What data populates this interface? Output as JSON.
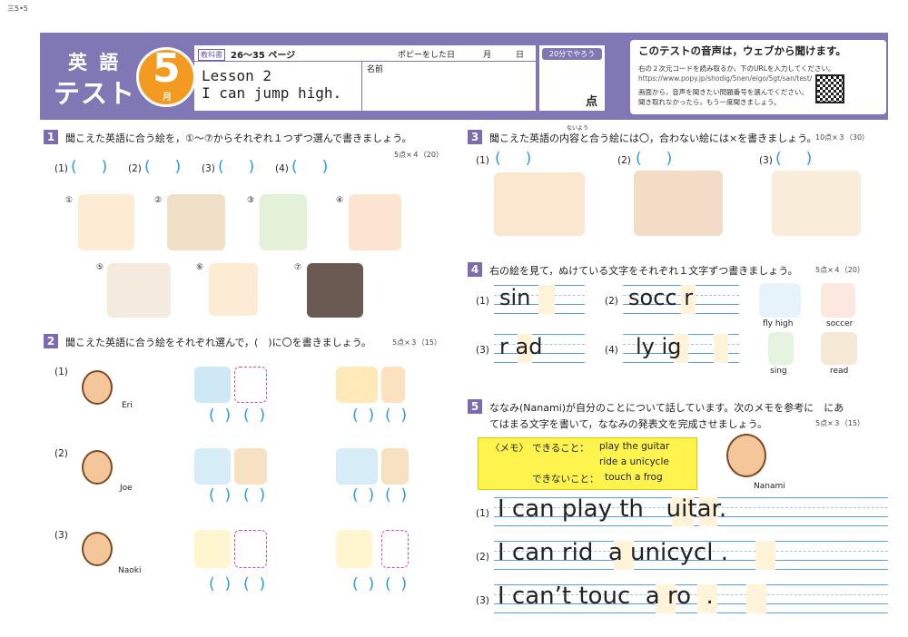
{
  "corner": "三5•5",
  "header": {
    "subject1": "英 語",
    "subject2": "テスト",
    "month_num": "5",
    "month_unit": "月",
    "textbook_tag": "教科書",
    "pages": "26〜35 ページ",
    "did_label": "ポピーをした日",
    "month_label": "月",
    "day_label": "日",
    "lesson": "Lesson 2",
    "lesson_title": "I can jump high.",
    "name_label": "名前",
    "time_tag": "20分でやろう",
    "score_unit": "点"
  },
  "audio": {
    "title": "このテストの音声は，ウェブから聞けます。",
    "line1": "右の２次元コードを読み取るか，下のURLを入力してください。",
    "url": "https://www.popy.jp/shodig/5nen/eigo/5gt/san/test/",
    "line3": "画面から，音声を聞きたい問題番号を選んでください。",
    "line4": "聞き取れなかったら，もう一度聞きましょう。"
  },
  "q1": {
    "num": "1",
    "text": "聞こえた英語に合う絵を，①〜⑦からそれぞれ１つずつ選んで書きましょう。",
    "points": "5点×４（20）",
    "subs": [
      "(1)",
      "(2)",
      "(3)",
      "(4)"
    ],
    "paren_open": "(",
    "paren_close": ")",
    "pics": [
      "①",
      "②",
      "③",
      "④",
      "⑤",
      "⑥",
      "⑦"
    ]
  },
  "q2": {
    "num": "2",
    "text": "聞こえた英語に合う絵をそれぞれ選んで，(　)に〇を書きましょう。",
    "points": "5点×３（15）",
    "subs": [
      "(1)",
      "(2)",
      "(3)"
    ],
    "names": [
      "Eri",
      "Joe",
      "Naoki"
    ]
  },
  "q3": {
    "num": "3",
    "text": "聞こえた英語の内容と合う絵には〇，合わない絵には×を書きましょう。",
    "ruby": "ないよう",
    "points": "10点×３（30）",
    "subs": [
      "(1)",
      "(2)",
      "(3)"
    ]
  },
  "q4": {
    "num": "4",
    "text": "右の絵を見て，ぬけている文字をそれぞれ１文字ずつ書きましょう。",
    "points": "5点×４（20）",
    "subs": [
      "(1)",
      "(2)",
      "(3)",
      "(4)"
    ],
    "words": [
      "sin",
      "socc r",
      "r ad",
      "ly ig"
    ],
    "labels": [
      "fly high",
      "soccer",
      "sing",
      "read"
    ]
  },
  "q5": {
    "num": "5",
    "text1": "ななみ(Nanami)が自分のことについて話しています。次のメモを参考に　にあ",
    "text2": "てはまる文字を書いて，ななみの発表文を完成させましょう。",
    "points": "5点×３（15）",
    "memo_label": "〈メモ〉",
    "can_label": "できること：",
    "can1": "play the guitar",
    "can2": "ride a unicycle",
    "cannot_label": "できないこと：",
    "cannot1": "touch a frog",
    "name": "Nanami",
    "subs": [
      "(1)",
      "(2)",
      "(3)"
    ],
    "sentences": [
      "I can play th   uitar.",
      "I can rid  a unicycl .",
      "I can’t touc  a ro  ."
    ]
  }
}
